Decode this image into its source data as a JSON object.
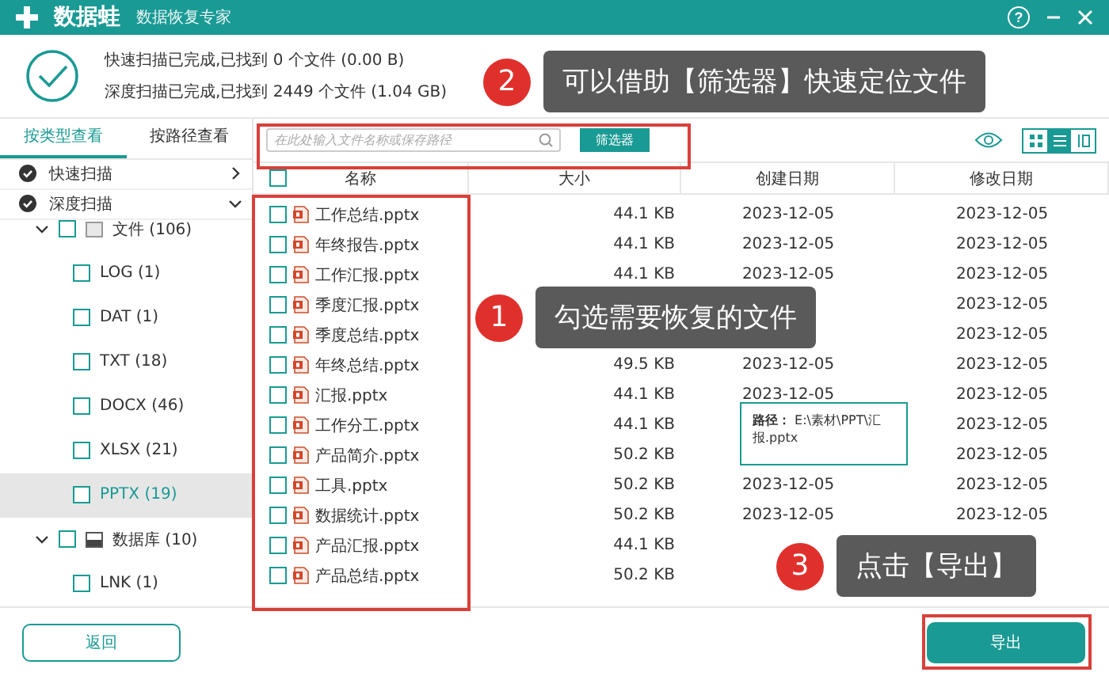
{
  "app": {
    "logo": "数据蛙",
    "subtitle": "数据恢复专家",
    "help": "?"
  },
  "summary": {
    "lines": [
      "快速扫描已完成,已找到 0 个文件 (0.00  B)",
      "深度扫描已完成,已找到 2449 个文件 (1.04 GB)"
    ]
  },
  "view_tabs": [
    {
      "label": "按类型查看",
      "selected": true
    },
    {
      "label": "按路径查看",
      "selected": false
    }
  ],
  "search": {
    "placeholder": "在此处输入文件名称或保存路径"
  },
  "filter_button": "筛选器",
  "view_modes": [
    {
      "kind": "grid",
      "selected": false
    },
    {
      "kind": "list",
      "selected": true
    },
    {
      "kind": "detail",
      "selected": false
    }
  ],
  "scans": [
    {
      "label": "快速扫描",
      "expanded": false
    },
    {
      "label": "深度扫描",
      "expanded": true
    }
  ],
  "tree": [
    {
      "label": "文件 (106)",
      "kind": "folder",
      "expanded": true,
      "checked": false,
      "children": [
        {
          "label": "LOG (1)",
          "checked": false,
          "selected": false
        },
        {
          "label": "DAT (1)",
          "checked": false,
          "selected": false
        },
        {
          "label": "TXT (18)",
          "checked": false,
          "selected": false
        },
        {
          "label": "DOCX (46)",
          "checked": false,
          "selected": false
        },
        {
          "label": "XLSX (21)",
          "checked": false,
          "selected": false
        },
        {
          "label": "PPTX (19)",
          "checked": false,
          "selected": true
        }
      ]
    },
    {
      "label": "数据库 (10)",
      "kind": "database",
      "expanded": true,
      "checked": false,
      "children": [
        {
          "label": "LNK (1)",
          "checked": false,
          "selected": false
        }
      ]
    }
  ],
  "table": {
    "columns": [
      "名称",
      "大小",
      "创建日期",
      "修改日期"
    ],
    "rows": [
      {
        "name": "工作总结.pptx",
        "size": "44.1 KB",
        "created": "2023-12-05",
        "modified": "2023-12-05",
        "checked": false
      },
      {
        "name": "年终报告.pptx",
        "size": "44.1 KB",
        "created": "2023-12-05",
        "modified": "2023-12-05",
        "checked": false
      },
      {
        "name": "工作汇报.pptx",
        "size": "44.1 KB",
        "created": "2023-12-05",
        "modified": "2023-12-05",
        "checked": false
      },
      {
        "name": "季度汇报.pptx",
        "modified": "2023-12-05",
        "checked": false
      },
      {
        "name": "季度总结.pptx",
        "modified": "2023-12-05",
        "checked": false
      },
      {
        "name": "年终总结.pptx",
        "size": "49.5 KB",
        "created": "2023-12-05",
        "modified": "2023-12-05",
        "checked": false
      },
      {
        "name": "汇报.pptx",
        "size": "44.1 KB",
        "created": "2023-12-05",
        "modified": "2023-12-05",
        "checked": false
      },
      {
        "name": "工作分工.pptx",
        "size": "44.1 KB",
        "modified": "2023-12-05",
        "checked": false
      },
      {
        "name": "产品简介.pptx",
        "size": "50.2 KB",
        "modified": "2023-12-05",
        "checked": false
      },
      {
        "name": "工具.pptx",
        "size": "50.2 KB",
        "created": "2023-12-05",
        "modified": "2023-12-05",
        "checked": false
      },
      {
        "name": "数据统计.pptx",
        "size": "50.2 KB",
        "created": "2023-12-05",
        "modified": "2023-12-05",
        "checked": false
      },
      {
        "name": "产品汇报.pptx",
        "size": "44.1 KB",
        "checked": false
      },
      {
        "name": "产品总结.pptx",
        "size": "50.2 KB",
        "checked": false
      }
    ]
  },
  "select_all": {
    "checked": false
  },
  "tooltip": {
    "label": "路径：",
    "value": "E:\\素材\\PPT\\汇报.pptx"
  },
  "buttons": {
    "back": "返回",
    "export": "导出"
  },
  "annotations": [
    {
      "number": "2",
      "text": "可以借助【筛选器】快速定位文件"
    },
    {
      "number": "1",
      "text": "勾选需要恢复的文件"
    },
    {
      "number": "3",
      "text": "点击【导出】"
    }
  ]
}
